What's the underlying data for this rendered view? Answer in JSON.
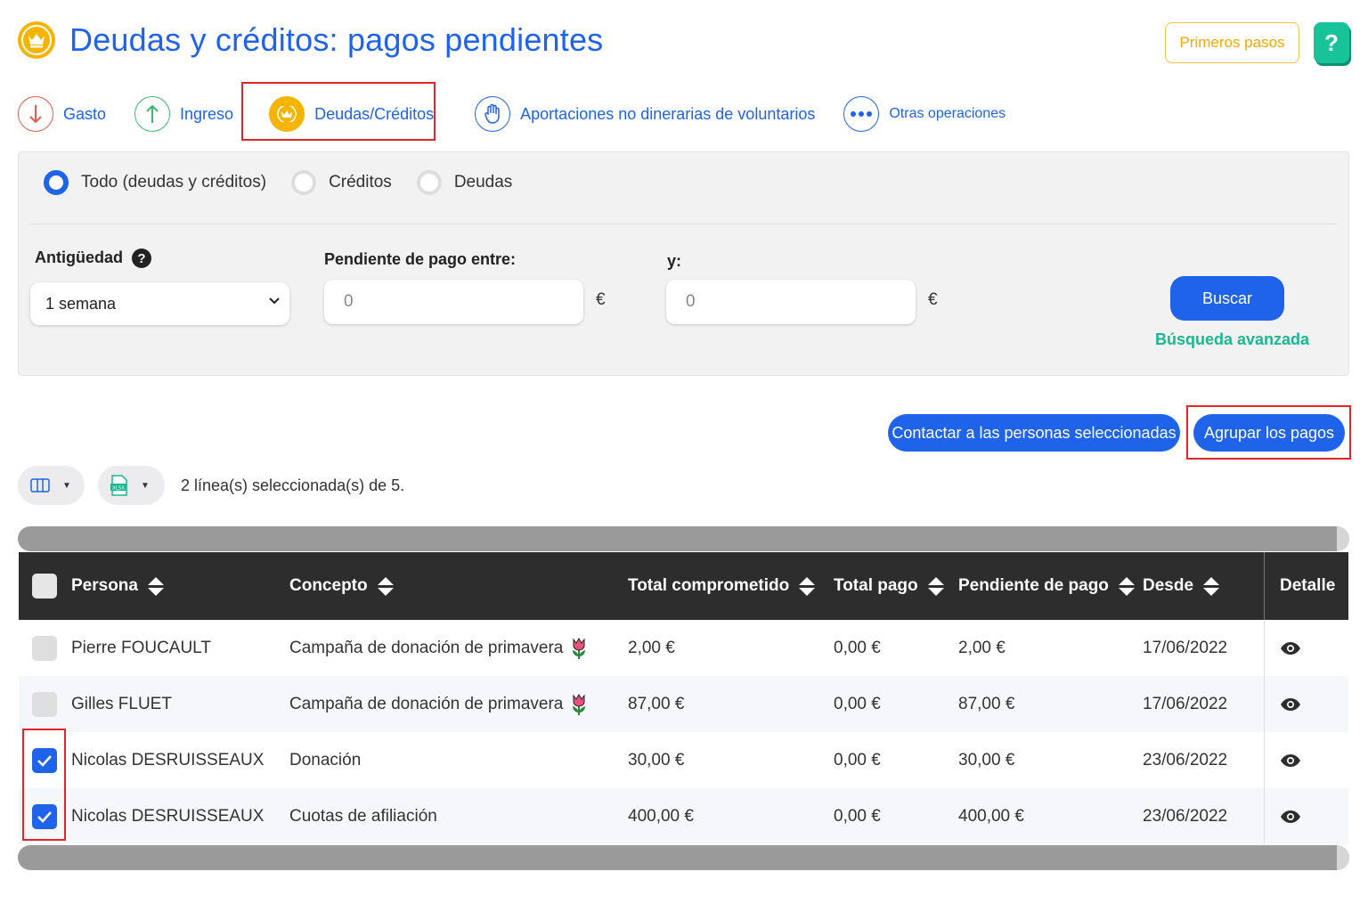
{
  "header": {
    "title": "Deudas y créditos: pagos pendientes",
    "first_steps": "Primeros pasos",
    "help": "?"
  },
  "tabs": [
    {
      "label": "Gasto",
      "icon": "arrow-down-icon",
      "color": "#e65b4a"
    },
    {
      "label": "Ingreso",
      "icon": "arrow-up-icon",
      "color": "#3db86c"
    },
    {
      "label": "Deudas/Créditos",
      "icon": "crown-icon",
      "color": "#f5b400",
      "active": true
    },
    {
      "label": "Aportaciones no dinerarias de voluntarios",
      "icon": "hand-icon",
      "color": "#1e63e9"
    },
    {
      "label": "Otras operaciones",
      "icon": "more-dots-icon",
      "color": "#1e63e9"
    }
  ],
  "filters": {
    "radios": [
      {
        "label": "Todo (deudas y créditos)",
        "checked": true
      },
      {
        "label": "Créditos",
        "checked": false
      },
      {
        "label": "Deudas",
        "checked": false
      }
    ],
    "age_label": "Antigüedad",
    "age_value": "1 semana",
    "pending_label": "Pendiente de pago entre:",
    "and_label": "y:",
    "min_placeholder": "0",
    "max_placeholder": "0",
    "currency": "€",
    "search": "Buscar",
    "advanced": "Búsqueda avanzada"
  },
  "actions": {
    "contact": "Contactar a las personas seleccionadas",
    "group": "Agrupar los pagos"
  },
  "toolbar": {
    "selection": "2 línea(s) seleccionada(s) de 5."
  },
  "table": {
    "headers": {
      "persona": "Persona",
      "concepto": "Concepto",
      "total": "Total comprometido",
      "pagado": "Total pago",
      "pendiente": "Pendiente de pago",
      "desde": "Desde",
      "detalle": "Detalle"
    },
    "rows": [
      {
        "persona": "Pierre FOUCAULT",
        "concepto": "Campaña de donación de primavera",
        "tulip": true,
        "total": "2,00 €",
        "pagado": "0,00 €",
        "pendiente": "2,00 €",
        "desde": "17/06/2022",
        "checked": false
      },
      {
        "persona": "Gilles FLUET",
        "concepto": "Campaña de donación de primavera",
        "tulip": true,
        "total": "87,00 €",
        "pagado": "0,00 €",
        "pendiente": "87,00 €",
        "desde": "17/06/2022",
        "checked": false
      },
      {
        "persona": "Nicolas DESRUISSEAUX",
        "concepto": "Donación",
        "tulip": false,
        "total": "30,00 €",
        "pagado": "0,00 €",
        "pendiente": "30,00 €",
        "desde": "23/06/2022",
        "checked": true
      },
      {
        "persona": "Nicolas DESRUISSEAUX",
        "concepto": "Cuotas de afiliación",
        "tulip": false,
        "total": "400,00 €",
        "pagado": "0,00 €",
        "pendiente": "400,00 €",
        "desde": "23/06/2022",
        "checked": true
      }
    ]
  },
  "colors": {
    "primary": "#1e63e9",
    "accent_green": "#19b88f",
    "crown": "#f5b400",
    "highlight_red": "#e0262b"
  }
}
